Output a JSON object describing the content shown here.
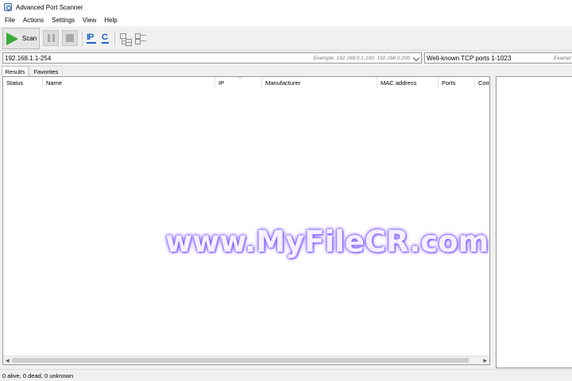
{
  "window": {
    "title": "Advanced Port Scanner"
  },
  "menu": {
    "items": [
      "File",
      "Actions",
      "Settings",
      "View",
      "Help"
    ]
  },
  "toolbar": {
    "scan_label": "Scan",
    "ip_label": "IP",
    "c_label": "C"
  },
  "ip_range": {
    "value": "192.168.1.1-254",
    "hint": "Example: 192.168.0.1-100, 192.168.0.200"
  },
  "ports": {
    "value": "Well-known TCP ports 1-1023",
    "hint": "Exampl"
  },
  "tabs": [
    {
      "label": "Results",
      "active": true
    },
    {
      "label": "Favorites",
      "active": false
    }
  ],
  "table": {
    "columns": [
      "Status",
      "Name",
      "IP",
      "Manufacturer",
      "MAC address",
      "Ports",
      "Com"
    ],
    "sort_indicator": "^",
    "rows": []
  },
  "watermark": "www.MyFileCR.com",
  "status": {
    "text": "0 alive, 0 dead, 0 unknown"
  },
  "icons": {
    "app": "scanner-app-icon",
    "scan": "play-icon",
    "pause": "pause-icon",
    "stop": "stop-icon",
    "expand": "expand-tree-icon",
    "collapse": "collapse-tree-icon"
  },
  "colors": {
    "scan_green": "#3aa83a",
    "ip_blue": "#1e62c8"
  }
}
